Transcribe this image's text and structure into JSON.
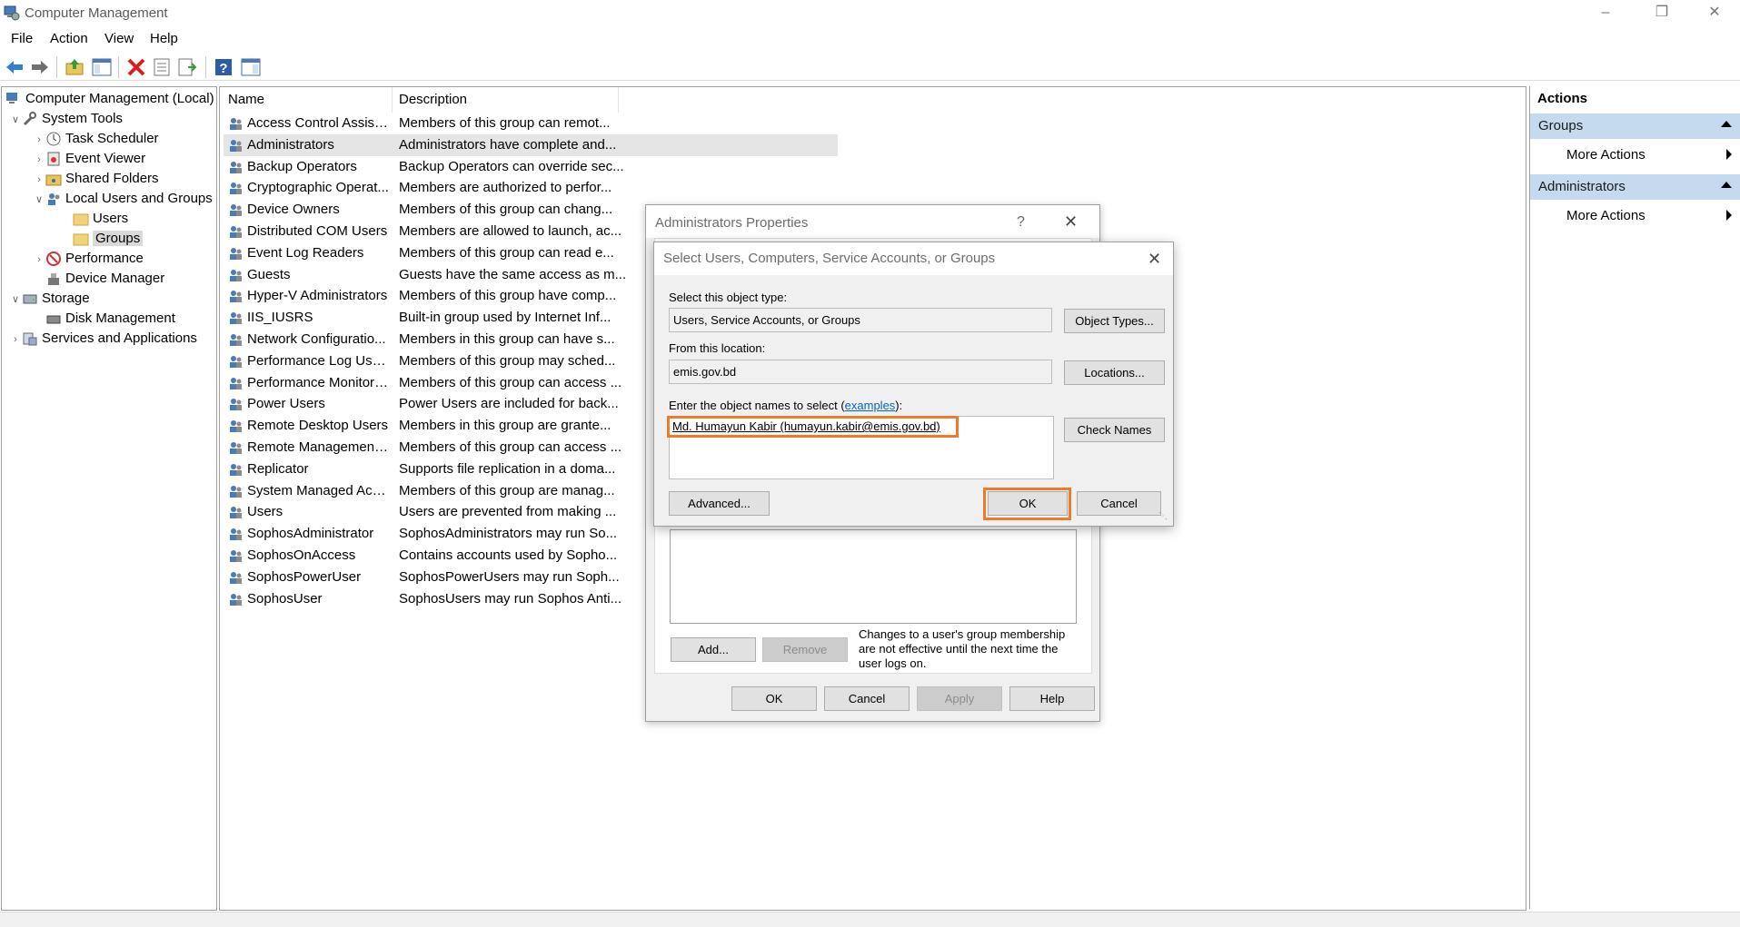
{
  "window": {
    "title": "Computer Management"
  },
  "menu": [
    "File",
    "Action",
    "View",
    "Help"
  ],
  "tree": {
    "root": "Computer Management (Local)",
    "system_tools": "System Tools",
    "task_scheduler": "Task Scheduler",
    "event_viewer": "Event Viewer",
    "shared_folders": "Shared Folders",
    "local_users_groups": "Local Users and Groups",
    "users": "Users",
    "groups": "Groups",
    "performance": "Performance",
    "device_manager": "Device Manager",
    "storage": "Storage",
    "disk_management": "Disk Management",
    "services_apps": "Services and Applications"
  },
  "list": {
    "col_name": "Name",
    "col_desc": "Description",
    "rows": [
      {
        "name": "Access Control Assista...",
        "desc": "Members of this group can remot..."
      },
      {
        "name": "Administrators",
        "desc": "Administrators have complete and..."
      },
      {
        "name": "Backup Operators",
        "desc": "Backup Operators can override sec..."
      },
      {
        "name": "Cryptographic Operat...",
        "desc": "Members are authorized to perfor..."
      },
      {
        "name": "Device Owners",
        "desc": "Members of this group can chang..."
      },
      {
        "name": "Distributed COM Users",
        "desc": "Members are allowed to launch, ac..."
      },
      {
        "name": "Event Log Readers",
        "desc": "Members of this group can read e..."
      },
      {
        "name": "Guests",
        "desc": "Guests have the same access as m..."
      },
      {
        "name": "Hyper-V Administrators",
        "desc": "Members of this group have comp..."
      },
      {
        "name": "IIS_IUSRS",
        "desc": "Built-in group used by Internet Inf..."
      },
      {
        "name": "Network Configuratio...",
        "desc": "Members in this group can have s..."
      },
      {
        "name": "Performance Log Users",
        "desc": "Members of this group may sched..."
      },
      {
        "name": "Performance Monitor ...",
        "desc": "Members of this group can access ..."
      },
      {
        "name": "Power Users",
        "desc": "Power Users are included for back..."
      },
      {
        "name": "Remote Desktop Users",
        "desc": "Members in this group are grante..."
      },
      {
        "name": "Remote Management ...",
        "desc": "Members of this group can access ..."
      },
      {
        "name": "Replicator",
        "desc": "Supports file replication in a doma..."
      },
      {
        "name": "System Managed Acco...",
        "desc": "Members of this group are manag..."
      },
      {
        "name": "Users",
        "desc": "Users are prevented from making ..."
      },
      {
        "name": "SophosAdministrator",
        "desc": "SophosAdministrators may run So..."
      },
      {
        "name": "SophosOnAccess",
        "desc": "Contains accounts used by Sopho..."
      },
      {
        "name": "SophosPowerUser",
        "desc": "SophosPowerUsers may run Soph..."
      },
      {
        "name": "SophosUser",
        "desc": "SophosUsers may run Sophos Anti..."
      }
    ]
  },
  "actions": {
    "title": "Actions",
    "group1": "Groups",
    "more1": "More Actions",
    "group2": "Administrators",
    "more2": "More Actions"
  },
  "props_dialog": {
    "title": "Administrators Properties",
    "help_glyph": "?",
    "add": "Add...",
    "remove": "Remove",
    "note": "Changes to a user's group membership are not effective until the next time the user logs on.",
    "ok": "OK",
    "cancel": "Cancel",
    "apply": "Apply",
    "help": "Help"
  },
  "select_dialog": {
    "title": "Select Users, Computers, Service Accounts, or Groups",
    "object_type_label": "Select this object type:",
    "object_type_value": "Users, Service Accounts, or Groups",
    "object_types_btn": "Object Types...",
    "location_label": "From this location:",
    "location_value": "emis.gov.bd",
    "locations_btn": "Locations...",
    "names_label_pre": "Enter the object names to select (",
    "names_label_link": "examples",
    "names_label_post": "):",
    "names_value": "Md. Humayun Kabir (humayun.kabir@emis.gov.bd)",
    "check_names_btn": "Check Names",
    "advanced_btn": "Advanced...",
    "ok": "OK",
    "cancel": "Cancel"
  },
  "colors": {
    "highlight": "#ef7a2a",
    "actions_header": "#c5d9ef",
    "link": "#0066cc"
  }
}
